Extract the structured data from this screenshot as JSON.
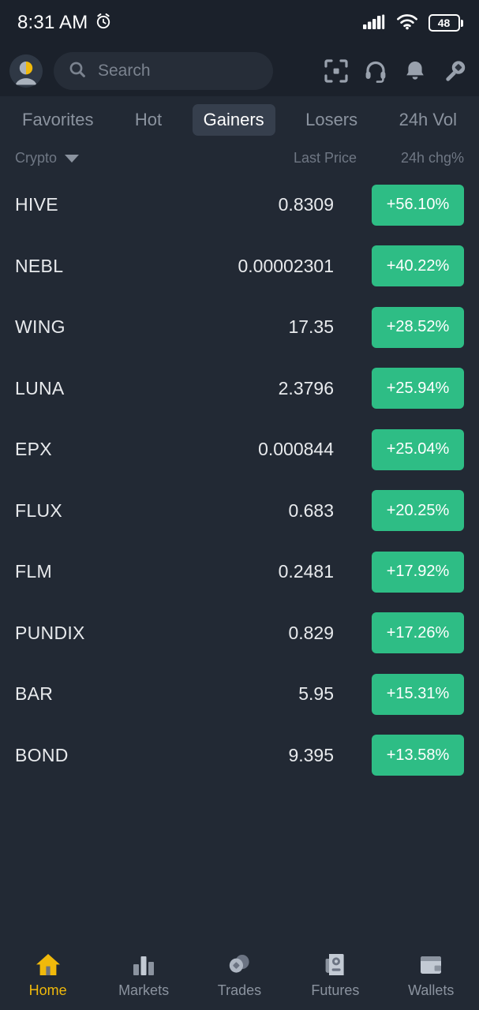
{
  "status_bar": {
    "time": "8:31 AM",
    "alarm_icon": "alarm-clock-icon",
    "signal_icon": "cellular-signal-icon",
    "wifi_icon": "wifi-icon",
    "battery_level": "48"
  },
  "header": {
    "avatar_icon": "user-avatar-icon",
    "search_placeholder": "Search",
    "search_value": "",
    "icons": [
      {
        "name": "qr-scan-icon",
        "label": "Scan"
      },
      {
        "name": "headset-support-icon",
        "label": "Support"
      },
      {
        "name": "bell-notification-icon",
        "label": "Notifications"
      },
      {
        "name": "rewards-tag-icon",
        "label": "Rewards"
      }
    ]
  },
  "tabs": [
    {
      "label": "Favorites",
      "active": false
    },
    {
      "label": "Hot",
      "active": false
    },
    {
      "label": "Gainers",
      "active": true
    },
    {
      "label": "Losers",
      "active": false
    },
    {
      "label": "24h Vol",
      "active": false
    }
  ],
  "column_headers": {
    "category": "Crypto",
    "category_caret_icon": "chevron-down-icon",
    "price": "Last Price",
    "change": "24h chg%"
  },
  "colors": {
    "gain_green": "#2ebd85",
    "accent_yellow": "#f0b90b",
    "page_bg": "#222934",
    "header_bg": "#1b212b",
    "active_tab_bg": "#363f4d"
  },
  "market_rows": [
    {
      "symbol": "HIVE",
      "price": "0.8309",
      "change": "+56.10%"
    },
    {
      "symbol": "NEBL",
      "price": "0.00002301",
      "change": "+40.22%"
    },
    {
      "symbol": "WING",
      "price": "17.35",
      "change": "+28.52%"
    },
    {
      "symbol": "LUNA",
      "price": "2.3796",
      "change": "+25.94%"
    },
    {
      "symbol": "EPX",
      "price": "0.000844",
      "change": "+25.04%"
    },
    {
      "symbol": "FLUX",
      "price": "0.683",
      "change": "+20.25%"
    },
    {
      "symbol": "FLM",
      "price": "0.2481",
      "change": "+17.92%"
    },
    {
      "symbol": "PUNDIX",
      "price": "0.829",
      "change": "+17.26%"
    },
    {
      "symbol": "BAR",
      "price": "5.95",
      "change": "+15.31%"
    },
    {
      "symbol": "BOND",
      "price": "9.395",
      "change": "+13.58%"
    }
  ],
  "bottom_nav": [
    {
      "label": "Home",
      "icon": "home-icon",
      "active": true
    },
    {
      "label": "Markets",
      "icon": "bar-chart-icon",
      "active": false
    },
    {
      "label": "Trades",
      "icon": "coins-icon",
      "active": false
    },
    {
      "label": "Futures",
      "icon": "contract-icon",
      "active": false
    },
    {
      "label": "Wallets",
      "icon": "wallet-icon",
      "active": false
    }
  ]
}
